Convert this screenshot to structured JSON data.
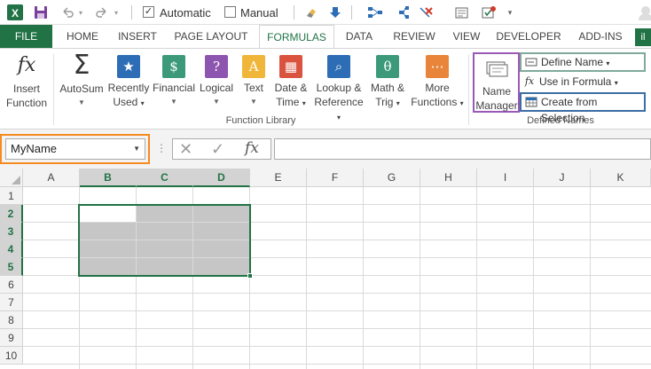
{
  "qat": {
    "automatic_label": "Automatic",
    "manual_label": "Manual",
    "automatic_checked": true,
    "manual_checked": false
  },
  "tabs": [
    "FILE",
    "HOME",
    "INSERT",
    "PAGE LAYOUT",
    "FORMULAS",
    "DATA",
    "REVIEW",
    "VIEW",
    "DEVELOPER",
    "ADD-INS"
  ],
  "active_tab": "FORMULAS",
  "ribbon": {
    "insert_function": "Insert Function",
    "autosum": "AutoSum",
    "recently_used": "Recently Used",
    "financial": "Financial",
    "logical": "Logical",
    "text": "Text",
    "date_time": "Date & Time",
    "lookup_reference": "Lookup & Reference",
    "math_trig": "Math & Trig",
    "more_functions": "More Functions",
    "function_library_label": "Function Library",
    "name_manager": "Name Manager",
    "define_name": "Define Name",
    "use_in_formula": "Use in Formula",
    "create_from_selection": "Create from Selection",
    "defined_names_label": "Defined Names"
  },
  "formula_bar": {
    "name_box_value": "MyName",
    "formula_value": ""
  },
  "columns": [
    "A",
    "B",
    "C",
    "D",
    "E",
    "F",
    "G",
    "H",
    "I",
    "J",
    "K"
  ],
  "rows": [
    "1",
    "2",
    "3",
    "4",
    "5",
    "6",
    "7",
    "8",
    "9",
    "10"
  ],
  "selected_columns": [
    "B",
    "C",
    "D"
  ],
  "selected_rows": [
    "2",
    "3",
    "4",
    "5"
  ],
  "selection_range": "B2:D5",
  "colors": {
    "excel_green": "#217346",
    "highlight_orange": "#f58a1f",
    "highlight_purple": "#9b59b6",
    "highlight_teal": "#7fa99b",
    "highlight_blue": "#3a6ea5",
    "selection_fill": "#c6c6c6"
  }
}
